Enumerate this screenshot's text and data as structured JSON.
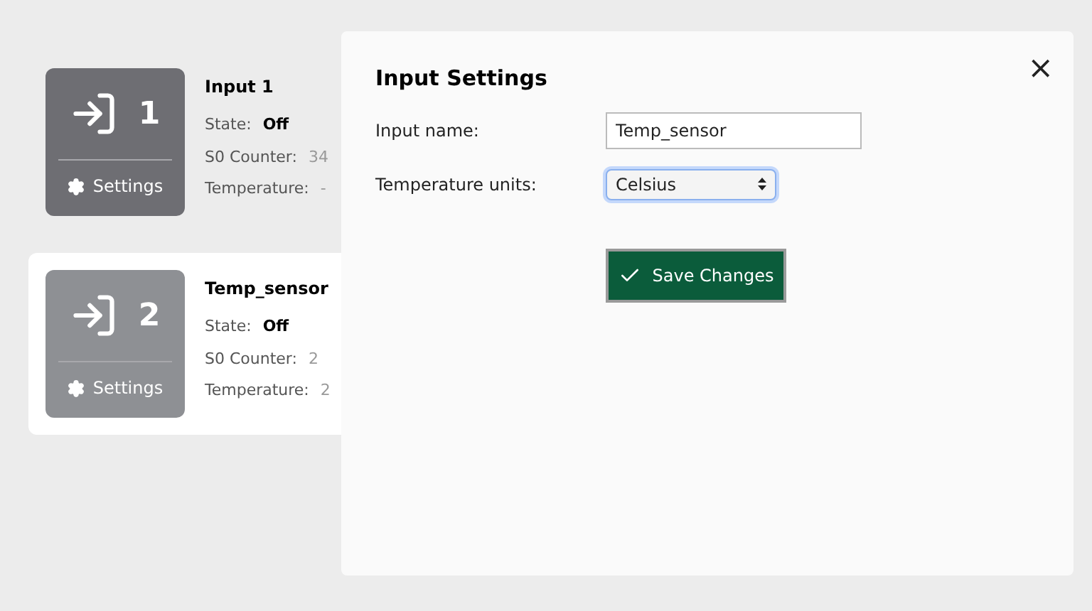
{
  "inputs": [
    {
      "number": "1",
      "settings_label": "Settings",
      "name": "Input 1",
      "selected": false,
      "fields": [
        {
          "label": "State:",
          "value": "Off",
          "bold": true
        },
        {
          "label": "S0 Counter:",
          "value": "34",
          "bold": false
        },
        {
          "label": "Temperature:",
          "value": "-",
          "bold": false
        }
      ]
    },
    {
      "number": "2",
      "settings_label": "Settings",
      "name": "Temp_sensor",
      "selected": true,
      "fields": [
        {
          "label": "State:",
          "value": "Off",
          "bold": true
        },
        {
          "label": "S0 Counter:",
          "value": "2",
          "bold": false
        },
        {
          "label": "Temperature:",
          "value": "2",
          "bold": false
        }
      ]
    }
  ],
  "dialog": {
    "title": "Input Settings",
    "close": "×",
    "name_label": "Input name:",
    "name_value": "Temp_sensor",
    "units_label": "Temperature units:",
    "units_value": "Celsius",
    "save_label": "Save Changes"
  }
}
